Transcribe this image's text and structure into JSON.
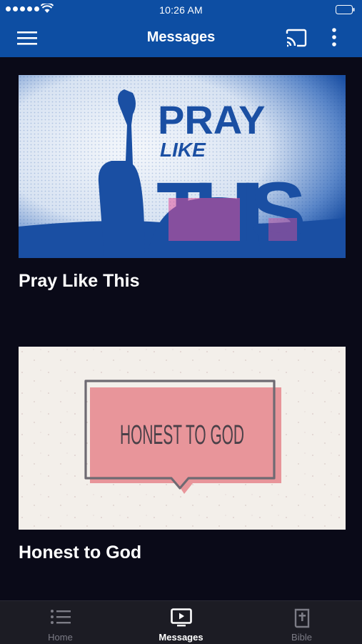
{
  "status_bar": {
    "time": "10:26 AM"
  },
  "navbar": {
    "title": "Messages",
    "menu_icon": "hamburger-menu-icon",
    "cast_icon": "cast-icon",
    "more_icon": "more-vertical-icon",
    "background": "#0d4ea3"
  },
  "messages": [
    {
      "title": "Pray Like This",
      "artwork": {
        "line1": "PRAY",
        "line2": "LIKE",
        "line3": "THIS"
      }
    },
    {
      "title": "Honest to God",
      "artwork": {
        "text": "HONEST TO GOD"
      }
    }
  ],
  "tabs": [
    {
      "label": "Home",
      "icon": "list-icon",
      "active": false
    },
    {
      "label": "Messages",
      "icon": "tv-play-icon",
      "active": true
    },
    {
      "label": "Bible",
      "icon": "bible-cross-icon",
      "active": false
    }
  ],
  "colors": {
    "accent": "#0d4ea3",
    "background": "#0a0a18",
    "tabbar": "#1c1c24",
    "tab_inactive": "#7c7c86",
    "tab_active": "#ffffff",
    "card1_blue": "#1a4fa3",
    "card1_pink": "#e0509a",
    "card2_pink": "#e8959a"
  }
}
